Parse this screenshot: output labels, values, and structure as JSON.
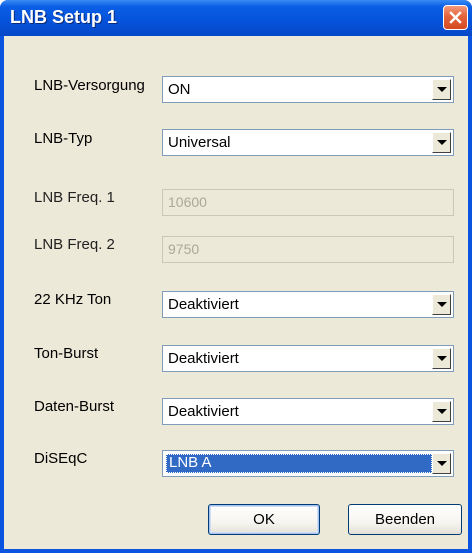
{
  "window": {
    "title": "LNB Setup 1"
  },
  "fields": {
    "lnb_versorgung": {
      "label": "LNB-Versorgung",
      "value": "ON"
    },
    "lnb_typ": {
      "label": "LNB-Typ",
      "value": "Universal"
    },
    "lnb_freq1": {
      "label": "LNB Freq. 1",
      "value": "10600"
    },
    "lnb_freq2": {
      "label": "LNB Freq. 2",
      "value": "9750"
    },
    "khz_ton": {
      "label": "22 KHz Ton",
      "value": "Deaktiviert"
    },
    "ton_burst": {
      "label": "Ton-Burst",
      "value": "Deaktiviert"
    },
    "daten_burst": {
      "label": "Daten-Burst",
      "value": "Deaktiviert"
    },
    "diseqc": {
      "label": "DiSEqC",
      "value": "LNB A"
    }
  },
  "buttons": {
    "ok": "OK",
    "cancel": "Beenden"
  }
}
